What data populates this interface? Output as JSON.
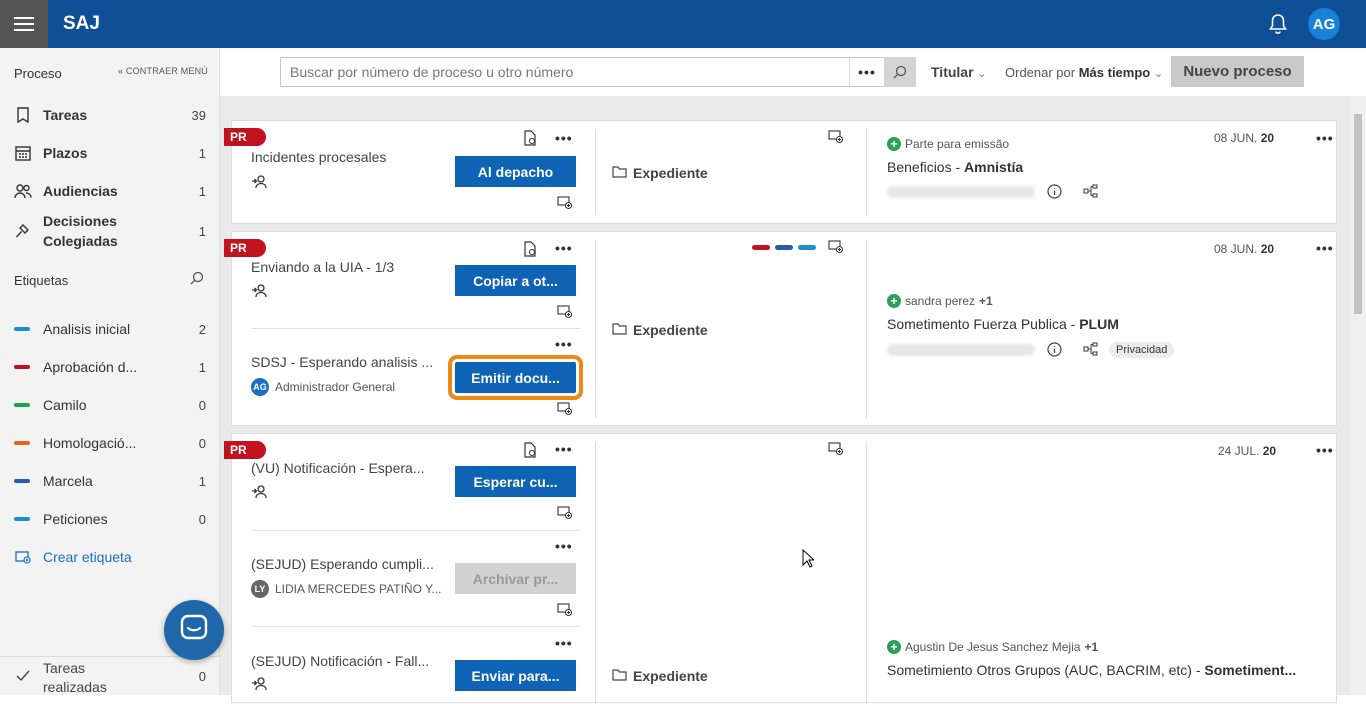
{
  "header": {
    "brand": "SAJ",
    "avatar": "AG"
  },
  "sidebar": {
    "heading": "Proceso",
    "collapse": "« CONTRAER MENÚ",
    "items": [
      {
        "label": "Tareas",
        "count": "39"
      },
      {
        "label": "Plazos",
        "count": "1"
      },
      {
        "label": "Audiencias",
        "count": "1"
      },
      {
        "label": "Decisiones Colegiadas",
        "count": "1"
      }
    ],
    "tags_heading": "Etiquetas",
    "tags": [
      {
        "label": "Analisis inicial",
        "count": "2",
        "color": "#1a8fd6"
      },
      {
        "label": "Aprobación d...",
        "count": "1",
        "color": "#c0121f"
      },
      {
        "label": "Camilo",
        "count": "0",
        "color": "#1fa24a"
      },
      {
        "label": "Homologació...",
        "count": "0",
        "color": "#e06a16"
      },
      {
        "label": "Marcela",
        "count": "1",
        "color": "#2c5aa8"
      },
      {
        "label": "Peticiones",
        "count": "0",
        "color": "#1a8fd6"
      }
    ],
    "create_tag": "Crear etiqueta",
    "bottom": {
      "label": "Tareas realizadas",
      "count": "0"
    }
  },
  "toolbar": {
    "search_placeholder": "Buscar por número de proceso u otro número",
    "more": "•••",
    "titular": "Titular",
    "orden_prefix": "Ordenar por",
    "orden_value": "Más tiempo",
    "nuevo": "Nuevo proceso"
  },
  "cards": [
    {
      "badge": "PR",
      "tasks": [
        {
          "title": "Incidentes procesales",
          "button": "Al depacho"
        }
      ],
      "expediente": "Expediente",
      "date_day": "08 JUN.",
      "date_year": "20",
      "person": "Parte para emissão",
      "case": "Beneficios - ",
      "case_bold": "Amnistía"
    },
    {
      "badge": "PR",
      "tasks": [
        {
          "title": "Enviando a la UIA - 1/3",
          "button": "Copiar a ot..."
        },
        {
          "title": "SDSJ - Esperando analisis ...",
          "button": "Emitir docu...",
          "user": "Administrador General",
          "initials": "AG"
        }
      ],
      "expediente": "Expediente",
      "date_day": "08 JUN.",
      "date_year": "20",
      "person": "sandra perez",
      "person_extra": "+1",
      "case": "Sometimento Fuerza Publica - ",
      "case_bold": "PLUM",
      "privacy": "Privacidad"
    },
    {
      "badge": "PR",
      "tasks": [
        {
          "title": "(VU) Notificación - Espera...",
          "button": "Esperar cu..."
        },
        {
          "title": "(SEJUD) Esperando cumpli...",
          "button": "Archivar pr...",
          "user": "LIDIA MERCEDES PATIÑO Y...",
          "initials": "LY"
        },
        {
          "title": "(SEJUD) Notificación - Fall...",
          "button": "Enviar para..."
        }
      ],
      "expediente": "Expediente",
      "date_day": "24 JUL.",
      "date_year": "20",
      "person": "Agustin De Jesus Sanchez Mejia",
      "person_extra": "+1",
      "case": "Sometimiento Otros Grupos (AUC, BACRIM, etc) - ",
      "case_bold": "Sometiment..."
    }
  ]
}
